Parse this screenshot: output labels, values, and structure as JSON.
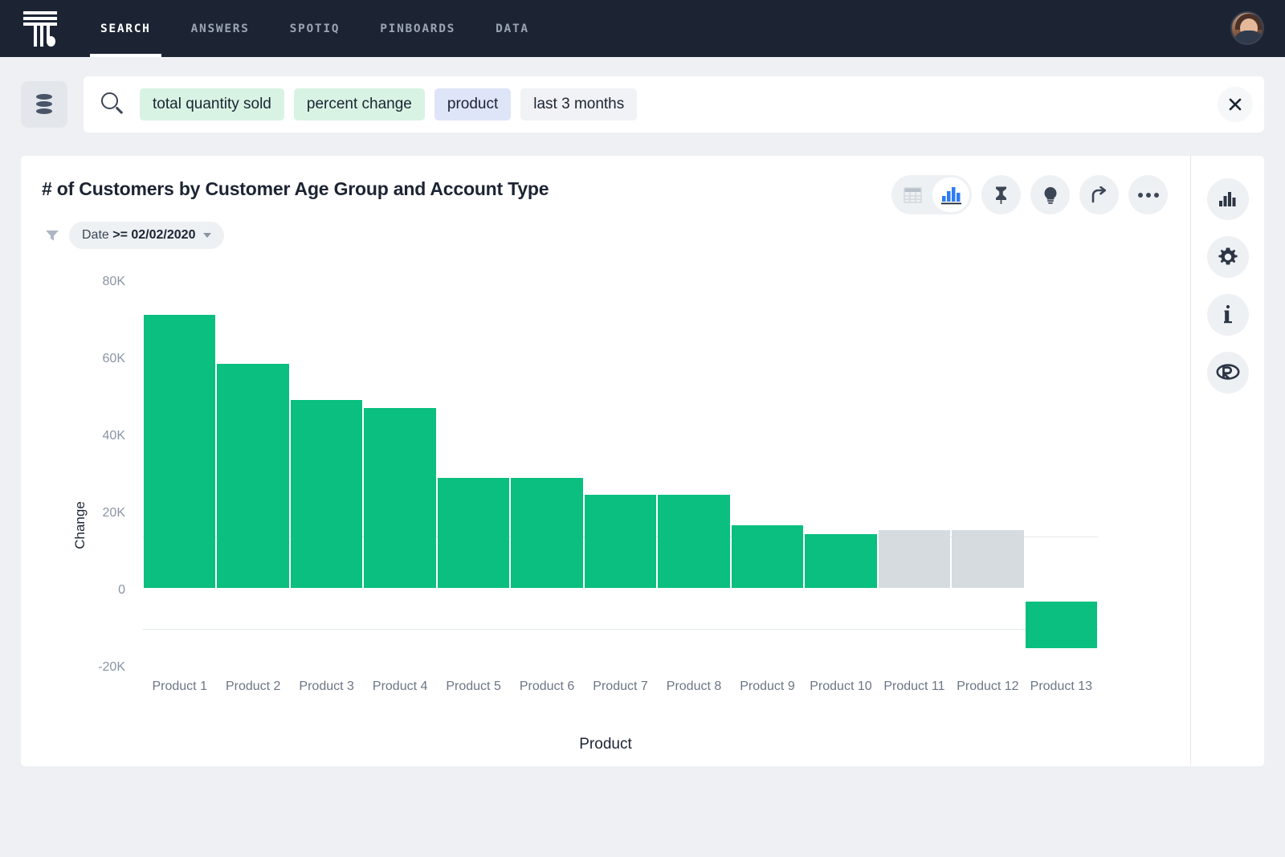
{
  "nav": {
    "logo_name": "thoughtspot-logo",
    "items": [
      {
        "label": "SEARCH",
        "active": true
      },
      {
        "label": "ANSWERS",
        "active": false
      },
      {
        "label": "SPOTIQ",
        "active": false
      },
      {
        "label": "PINBOARDS",
        "active": false
      },
      {
        "label": "DATA",
        "active": false
      }
    ],
    "avatar_name": "user-avatar"
  },
  "search": {
    "datasource_icon": "database-icon",
    "search_icon": "search-icon",
    "clear_icon": "close-icon",
    "tokens": [
      {
        "label": "total quantity sold",
        "style": "green"
      },
      {
        "label": "percent change",
        "style": "green"
      },
      {
        "label": "product",
        "style": "blue"
      },
      {
        "label": "last 3 months",
        "style": "gray"
      }
    ]
  },
  "card": {
    "title": "# of Customers by Customer Age Group and Account Type",
    "filter": {
      "icon": "filter-icon",
      "field": "Date",
      "condition": ">= 02/02/2020"
    },
    "toolbar": [
      {
        "name": "table-view-toggle",
        "icon": "table-icon",
        "active": false
      },
      {
        "name": "chart-view-toggle",
        "icon": "bar-chart-icon",
        "active": true
      },
      {
        "name": "pin-button",
        "icon": "pin-icon"
      },
      {
        "name": "spotiq-button",
        "icon": "lightbulb-icon"
      },
      {
        "name": "share-button",
        "icon": "share-arrow-icon"
      },
      {
        "name": "more-options-button",
        "icon": "ellipsis-icon"
      }
    ]
  },
  "rail": [
    {
      "name": "chart-config-button",
      "icon": "bar-chart-icon"
    },
    {
      "name": "settings-button",
      "icon": "gear-icon"
    },
    {
      "name": "info-button",
      "icon": "info-icon"
    },
    {
      "name": "r-analysis-button",
      "icon": "r-icon"
    }
  ],
  "chart_data": {
    "type": "bar",
    "title": "# of Customers by Customer Age Group and Account Type",
    "xlabel": "Product",
    "ylabel": "Change",
    "ylim": [
      -20000,
      80000
    ],
    "yticks": [
      80000,
      60000,
      40000,
      20000,
      0,
      -20000
    ],
    "ytick_labels": [
      "80K",
      "60K",
      "40K",
      "20K",
      "0",
      "-20K"
    ],
    "grid": true,
    "legend": "none",
    "colors": {
      "positive": "#0ABF7F",
      "neutral": "#d6dbdf"
    },
    "categories": [
      "Product 1",
      "Product 2",
      "Product 3",
      "Product 4",
      "Product 5",
      "Product 6",
      "Product 7",
      "Product 8",
      "Product 9",
      "Product 10",
      "Product 11",
      "Product 12",
      "Product 13"
    ],
    "values": [
      66700,
      54800,
      45800,
      44000,
      26900,
      26900,
      22700,
      22700,
      15200,
      13100,
      14200,
      14200,
      -14800
    ],
    "bar_colors": [
      "#0ABF7F",
      "#0ABF7F",
      "#0ABF7F",
      "#0ABF7F",
      "#0ABF7F",
      "#0ABF7F",
      "#0ABF7F",
      "#0ABF7F",
      "#0ABF7F",
      "#0ABF7F",
      "#d6dbdf",
      "#d6dbdf",
      "#0ABF7F"
    ],
    "bar_starts": [
      0,
      0,
      0,
      0,
      0,
      0,
      0,
      0,
      0,
      0,
      0,
      0,
      -3300
    ],
    "reference_lines": [
      12000,
      -12000
    ]
  }
}
